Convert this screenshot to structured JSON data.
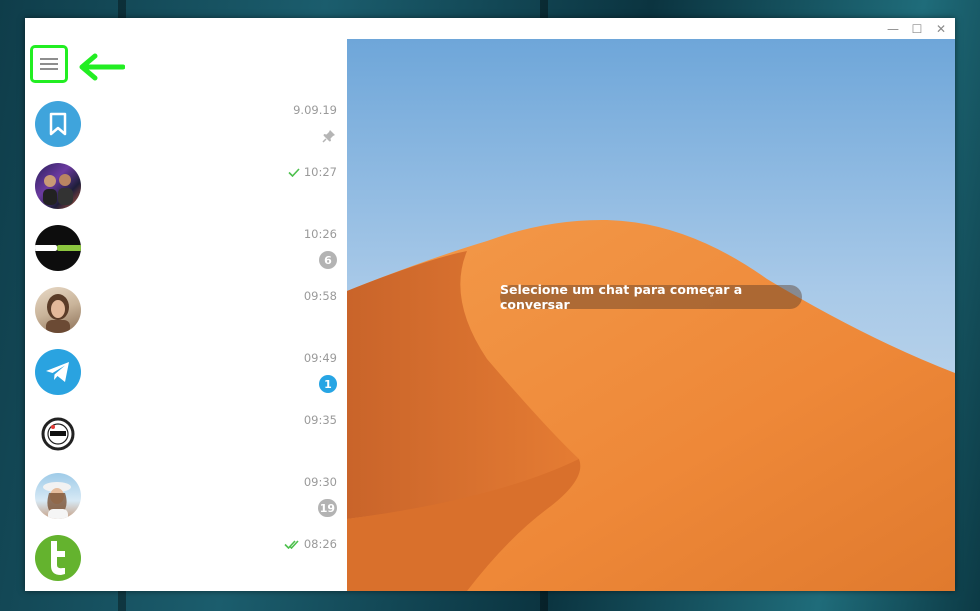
{
  "window": {
    "controls": {
      "minimize": "—",
      "maximize": "☐",
      "close": "✕"
    }
  },
  "sidebar": {
    "menu_icon": "hamburger-menu-icon",
    "annotation_arrow_color": "#22ee22",
    "chats": [
      {
        "avatar": "saved-messages-bookmark-icon",
        "time": "9.09.19",
        "pinned": true,
        "status": "",
        "unread": ""
      },
      {
        "avatar": "group-photo-avatar",
        "time": "10:27",
        "pinned": false,
        "status": "sent",
        "unread": ""
      },
      {
        "avatar": "tudocelular-logo-avatar",
        "time": "10:26",
        "pinned": false,
        "status": "",
        "unread": "6"
      },
      {
        "avatar": "woman-photo-avatar",
        "time": "09:58",
        "pinned": false,
        "status": "",
        "unread": ""
      },
      {
        "avatar": "telegram-logo-avatar",
        "time": "09:49",
        "pinned": false,
        "status": "",
        "unread": "1",
        "unread_active": true
      },
      {
        "avatar": "youtubers-badge-avatar",
        "time": "09:35",
        "pinned": false,
        "status": "",
        "unread": ""
      },
      {
        "avatar": "woman-hat-photo-avatar",
        "time": "09:30",
        "pinned": false,
        "status": "",
        "unread": "19"
      },
      {
        "avatar": "techtudo-t-logo-avatar",
        "time": "08:26",
        "pinned": false,
        "status": "read",
        "unread": ""
      }
    ]
  },
  "main": {
    "empty_hint": "Selecione um chat para começar a conversar",
    "wallpaper": "desert-dune-wallpaper"
  },
  "colors": {
    "accent": "#27a5e4",
    "check_green": "#4dc04d",
    "badge_muted": "#b3b3b3",
    "sky": "#7fb3df",
    "dune": "#f08a3c"
  }
}
